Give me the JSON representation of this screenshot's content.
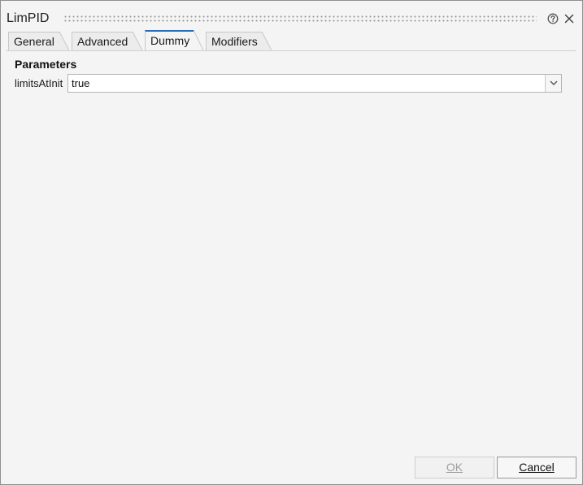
{
  "window": {
    "title": "LimPID"
  },
  "titlebar_icons": [
    "help-icon",
    "close-icon"
  ],
  "tabs": [
    {
      "label": "General",
      "active": false
    },
    {
      "label": "Advanced",
      "active": false
    },
    {
      "label": "Dummy",
      "active": true
    },
    {
      "label": "Modifiers",
      "active": false
    }
  ],
  "content": {
    "section_title": "Parameters",
    "params": [
      {
        "label": "limitsAtInit",
        "value": "true"
      }
    ]
  },
  "buttons": {
    "ok": {
      "label": "OK",
      "enabled": false
    },
    "cancel": {
      "label": "Cancel",
      "enabled": true
    }
  },
  "colors": {
    "active_tab_accent": "#2a6ebb",
    "disabled_text": "#9d9d9d"
  }
}
